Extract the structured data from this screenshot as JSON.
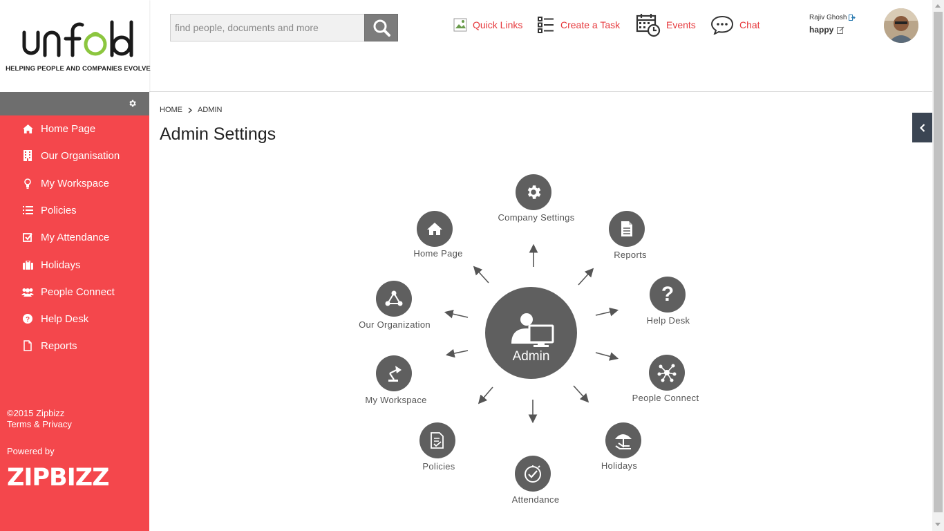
{
  "logo": {
    "word": "unfold",
    "tagline": "HELPING PEOPLE AND COMPANIES EVOLVE",
    "accent": "#8cc63f"
  },
  "search": {
    "placeholder": "find people, documents and more"
  },
  "toplinks": [
    {
      "label": "Quick Links",
      "icon": "broken-image-icon"
    },
    {
      "label": "Create a Task",
      "icon": "task-list-icon"
    },
    {
      "label": "Events",
      "icon": "calendar-clock-icon"
    },
    {
      "label": "Chat",
      "icon": "chat-bubble-icon"
    }
  ],
  "user": {
    "name": "Rajiv Ghosh",
    "status": "happy"
  },
  "sidebar": {
    "items": [
      {
        "label": "Home Page",
        "icon": "home-icon"
      },
      {
        "label": "Our Organisation",
        "icon": "building-icon"
      },
      {
        "label": "My Workspace",
        "icon": "lightbulb-icon"
      },
      {
        "label": "Policies",
        "icon": "list-icon"
      },
      {
        "label": "My Attendance",
        "icon": "check-square-icon"
      },
      {
        "label": "Holidays",
        "icon": "suitcase-icon"
      },
      {
        "label": "People Connect",
        "icon": "users-icon"
      },
      {
        "label": "Help Desk",
        "icon": "question-circle-icon"
      },
      {
        "label": "Reports",
        "icon": "document-icon"
      }
    ],
    "copyright": "©2015 Zipbizz",
    "terms": "Terms & Privacy",
    "powered_by": "Powered by",
    "brand": "ZIPBIZZ"
  },
  "breadcrumb": {
    "home": "HOME",
    "current": "ADMIN"
  },
  "page_title": "Admin Settings",
  "admin_center": {
    "label": "Admin"
  },
  "admin_nodes": [
    {
      "label": "Company Settings",
      "icon": "gear-icon"
    },
    {
      "label": "Reports",
      "icon": "report-doc-icon"
    },
    {
      "label": "Help Desk",
      "icon": "question-icon"
    },
    {
      "label": "People Connect",
      "icon": "network-icon"
    },
    {
      "label": "Holidays",
      "icon": "beach-umbrella-icon"
    },
    {
      "label": "Attendance",
      "icon": "clock-check-icon"
    },
    {
      "label": "Policies",
      "icon": "policy-doc-icon"
    },
    {
      "label": "My Workspace",
      "icon": "desk-lamp-icon"
    },
    {
      "label": "Our Organization",
      "icon": "org-triangle-icon"
    },
    {
      "label": "Home Page",
      "icon": "home-icon"
    }
  ],
  "colors": {
    "sidebar": "#f4474c",
    "sidebar_top": "#6e6e6e",
    "link": "#e6383c",
    "node": "#5f5f5f",
    "collapse": "#3b4553"
  }
}
